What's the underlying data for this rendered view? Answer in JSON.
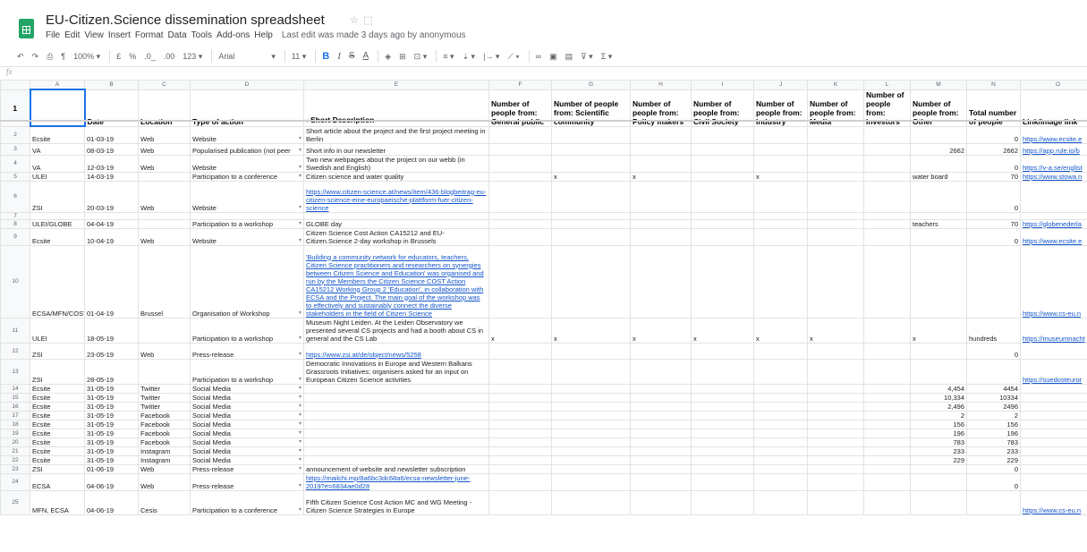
{
  "app": {
    "title": "EU-Citizen.Science dissemination spreadsheet",
    "menus": [
      "File",
      "Edit",
      "View",
      "Insert",
      "Format",
      "Data",
      "Tools",
      "Add-ons",
      "Help"
    ],
    "last_edit": "Last edit was made 3 days ago by anonymous"
  },
  "toolbar": {
    "zoom": "100%",
    "currency": "£",
    "percent": "%",
    "dec_less": ".0_",
    "dec_more": ".00",
    "format": "123",
    "font": "Arial",
    "font_size": "11",
    "bold": "B",
    "italic": "I",
    "strike": "S",
    "text_color": "A",
    "functions": "Σ"
  },
  "formula": {
    "fx": "fx"
  },
  "columns": [
    "A",
    "B",
    "C",
    "D",
    "E",
    "F",
    "G",
    "H",
    "I",
    "J",
    "K",
    "L",
    "M",
    "N",
    "O"
  ],
  "header": {
    "row_num": "1",
    "cells": [
      "",
      "Date",
      "Location",
      "Type of action",
      "Short Description",
      "Number of people from: General public",
      "Number of people from: Scientific community",
      "Number of people from: Policy makers",
      "Number of people from: Civil Society",
      "Number of people from: Industry",
      "Number of people from: Media",
      "Number of people from: Investors",
      "Number of people from: Other",
      "Total number of people",
      "Link/image link"
    ]
  },
  "rows": [
    {
      "n": "2",
      "h": 18,
      "a": "Ecsite",
      "b": "01-03-19",
      "c": "Web",
      "d": "Website",
      "e": "Short article about the project and the first project meeting in Berlin",
      "f": "",
      "g": "",
      "h2": "",
      "i": "",
      "j": "",
      "k": "",
      "l": "",
      "m": "",
      "total": "0",
      "link": "https://www.ecsite.e"
    },
    {
      "n": "3",
      "h": 13,
      "a": "VA",
      "b": "08-03-19",
      "c": "Web",
      "d": "Popularised publication (not peer",
      "e": "Short info in our newsletter",
      "f": "",
      "g": "",
      "h2": "",
      "i": "",
      "j": "",
      "k": "",
      "l": "",
      "m": "2662",
      "total": "2662",
      "link": "https://app.rule.io/b"
    },
    {
      "n": "4",
      "h": 18,
      "a": "VA",
      "b": "12-03-19",
      "c": "Web",
      "d": "Website",
      "e": "Two new webpages about the project on our webb (in Swedish and English)",
      "f": "",
      "g": "",
      "h2": "",
      "i": "",
      "j": "",
      "k": "",
      "l": "",
      "m": "",
      "total": "0",
      "link": "https://v-a.se/englist"
    },
    {
      "n": "5",
      "h": 9,
      "a": "ULEI",
      "b": "14-03-19",
      "c": "",
      "d": "Participation to a conference",
      "e": "Citizen science and water quality",
      "f": "",
      "g": "x",
      "h2": "x",
      "i": "",
      "j": "x",
      "k": "",
      "l": "",
      "m": "water board",
      "total": "70",
      "link": "https://www.stowa.n"
    },
    {
      "n": "6",
      "h": 35,
      "a": "ZSI",
      "b": "20-03-19",
      "c": "Web",
      "d": "Website",
      "e": "https://www.citizen-science.at/news/item/436-blogbeitrag-eu-citizen-science-eine-europaeische-plattform-fuer-citizen-science",
      "eLink": true,
      "f": "",
      "g": "",
      "h2": "",
      "i": "",
      "j": "",
      "k": "",
      "l": "",
      "m": "",
      "total": "0",
      "link": ""
    },
    {
      "n": "7",
      "h": 7,
      "a": "",
      "b": "",
      "c": "",
      "d": "",
      "e": "",
      "f": "",
      "g": "",
      "h2": "",
      "i": "",
      "j": "",
      "k": "",
      "l": "",
      "m": "",
      "total": "",
      "link": ""
    },
    {
      "n": "8",
      "h": 9,
      "a": "ULEI/GLOBE",
      "b": "04-04-19",
      "c": "",
      "d": "Participation to a workshop",
      "e": "GLOBE day",
      "f": "",
      "g": "",
      "h2": "",
      "i": "",
      "j": "",
      "k": "",
      "l": "",
      "m": "teachers",
      "total": "70",
      "link": "https://globenederla"
    },
    {
      "n": "9",
      "h": 18,
      "a": "Ecsite",
      "b": "10-04-19",
      "c": "Web",
      "d": "Website",
      "e": "Citizen Science Cost Action CA15212 and EU-Citizen.Science 2-day workshop in Brussels",
      "f": "",
      "g": "",
      "h2": "",
      "i": "",
      "j": "",
      "k": "",
      "l": "",
      "m": "",
      "total": "0",
      "link": "https://www.ecsite.e"
    },
    {
      "n": "10",
      "h": 81,
      "a": "ECSA/MFN/COST",
      "b": "01-04-19",
      "c": "Brussel",
      "d": "Organisation of Workshop",
      "e": "'Building a community network for educators, teachers, Citizen Science practitioners and researchers on synergies between Citizen Science and Education' was organised and run by the Members the Citizen Science COST Action CA15212 Working Group 2 'Education', in collaboration with ECSA and the Project. The main goal of the workshop was to effectively and sustainably connect the diverse stakeholders in the field of Citizen Science",
      "eUnder": true,
      "f": "",
      "g": "",
      "h2": "",
      "i": "",
      "j": "",
      "k": "",
      "l": "",
      "m": "",
      "total": "",
      "link": "https://www.cs-eu.n"
    },
    {
      "n": "11",
      "h": 27,
      "a": "ULEI",
      "b": "18-05-19",
      "c": "",
      "d": "Participation to a workshop",
      "e": "Museum Night Leiden. At the Leiden Observatory we presented several CS projects and had a booth about CS in general and the CS Lab",
      "f": "x",
      "g": "x",
      "h2": "x",
      "i": "x",
      "j": "x",
      "k": "x",
      "l": "",
      "m": "x",
      "total": "hundreds",
      "totalLeft": true,
      "link": "https://museumnacht"
    },
    {
      "n": "12",
      "h": 18,
      "a": "ZSI",
      "b": "23-05-19",
      "c": "Web",
      "d": "Press-release",
      "e": "https://www.zsi.at/de/object/news/5258",
      "eLink": true,
      "f": "",
      "g": "",
      "h2": "",
      "i": "",
      "j": "",
      "k": "",
      "l": "",
      "m": "",
      "total": "0",
      "link": ""
    },
    {
      "n": "13",
      "h": 27,
      "a": "ZSI",
      "b": "28-05-19",
      "c": "",
      "d": "Participation to a workshop",
      "e": "Democratic Innovations in Europe and Western Balkans Grassroots Initiatives; organisers asked for an input on European Citizen Science activities",
      "f": "",
      "g": "",
      "h2": "",
      "i": "",
      "j": "",
      "k": "",
      "l": "",
      "m": "",
      "total": "",
      "link": "https://suedosteuror"
    },
    {
      "n": "14",
      "h": 9,
      "a": "Ecsite",
      "b": "31-05-19",
      "c": "Twitter",
      "d": "Social Media",
      "e": "",
      "f": "",
      "g": "",
      "h2": "",
      "i": "",
      "j": "",
      "k": "",
      "l": "",
      "m": "4,454",
      "total": "4454",
      "link": ""
    },
    {
      "n": "15",
      "h": 9,
      "a": "Ecsite",
      "b": "31-05-19",
      "c": "Twitter",
      "d": "Social Media",
      "e": "",
      "f": "",
      "g": "",
      "h2": "",
      "i": "",
      "j": "",
      "k": "",
      "l": "",
      "m": "10,334",
      "total": "10334",
      "link": ""
    },
    {
      "n": "16",
      "h": 9,
      "a": "Ecsite",
      "b": "31-05-19",
      "c": "Twitter",
      "d": "Social Media",
      "e": "",
      "f": "",
      "g": "",
      "h2": "",
      "i": "",
      "j": "",
      "k": "",
      "l": "",
      "m": "2,496",
      "total": "2496",
      "link": ""
    },
    {
      "n": "17",
      "h": 9,
      "a": "Ecsite",
      "b": "31-05-19",
      "c": "Facebook",
      "d": "Social Media",
      "e": "",
      "f": "",
      "g": "",
      "h2": "",
      "i": "",
      "j": "",
      "k": "",
      "l": "",
      "m": "2",
      "total": "2",
      "link": ""
    },
    {
      "n": "18",
      "h": 9,
      "a": "Ecsite",
      "b": "31-05-19",
      "c": "Facebook",
      "d": "Social Media",
      "e": "",
      "f": "",
      "g": "",
      "h2": "",
      "i": "",
      "j": "",
      "k": "",
      "l": "",
      "m": "156",
      "total": "156",
      "link": ""
    },
    {
      "n": "19",
      "h": 9,
      "a": "Ecsite",
      "b": "31-05-19",
      "c": "Facebook",
      "d": "Social Media",
      "e": "",
      "f": "",
      "g": "",
      "h2": "",
      "i": "",
      "j": "",
      "k": "",
      "l": "",
      "m": "196",
      "total": "196",
      "link": ""
    },
    {
      "n": "20",
      "h": 9,
      "a": "Ecsite",
      "b": "31-05-19",
      "c": "Facebook",
      "d": "Social Media",
      "e": "",
      "f": "",
      "g": "",
      "h2": "",
      "i": "",
      "j": "",
      "k": "",
      "l": "",
      "m": "783",
      "total": "783",
      "link": ""
    },
    {
      "n": "21",
      "h": 9,
      "a": "Ecsite",
      "b": "31-05-19",
      "c": "Instagram",
      "d": "Social Media",
      "e": "",
      "f": "",
      "g": "",
      "h2": "",
      "i": "",
      "j": "",
      "k": "",
      "l": "",
      "m": "233",
      "total": "233",
      "link": ""
    },
    {
      "n": "22",
      "h": 9,
      "a": "Ecsite",
      "b": "31-05-19",
      "c": "Instagram",
      "d": "Social Media",
      "e": "",
      "f": "",
      "g": "",
      "h2": "",
      "i": "",
      "j": "",
      "k": "",
      "l": "",
      "m": "229",
      "total": "229",
      "link": ""
    },
    {
      "n": "23",
      "h": 9,
      "a": "ZSI",
      "b": "01-06-19",
      "c": "Web",
      "d": "Press-release",
      "e": "announcement of website and newsletter subscription",
      "f": "",
      "g": "",
      "h2": "",
      "i": "",
      "j": "",
      "k": "",
      "l": "",
      "m": "",
      "total": "0",
      "link": ""
    },
    {
      "n": "24",
      "h": 18,
      "a": "ECSA",
      "b": "04-06-19",
      "c": "Web",
      "d": "Press-release",
      "e": "https://mailchi.mp/8a6bc3dc68a6/ecsa-newsletter-june-2019?e=6834ae0d28",
      "eLink": true,
      "f": "",
      "g": "",
      "h2": "",
      "i": "",
      "j": "",
      "k": "",
      "l": "",
      "m": "",
      "total": "0",
      "link": ""
    },
    {
      "n": "25",
      "h": 27,
      "a": "MFN, ECSA",
      "b": "04-06-19",
      "c": "Cesis",
      "d": "Participation to a conference",
      "e": "Fifth Citizen Science Cost Action MC and WG Meeting - Citizen Science Strategies in Europe",
      "f": "",
      "g": "",
      "h2": "",
      "i": "",
      "j": "",
      "k": "",
      "l": "",
      "m": "",
      "total": "",
      "link": "https://www.cs-eu.n"
    }
  ]
}
